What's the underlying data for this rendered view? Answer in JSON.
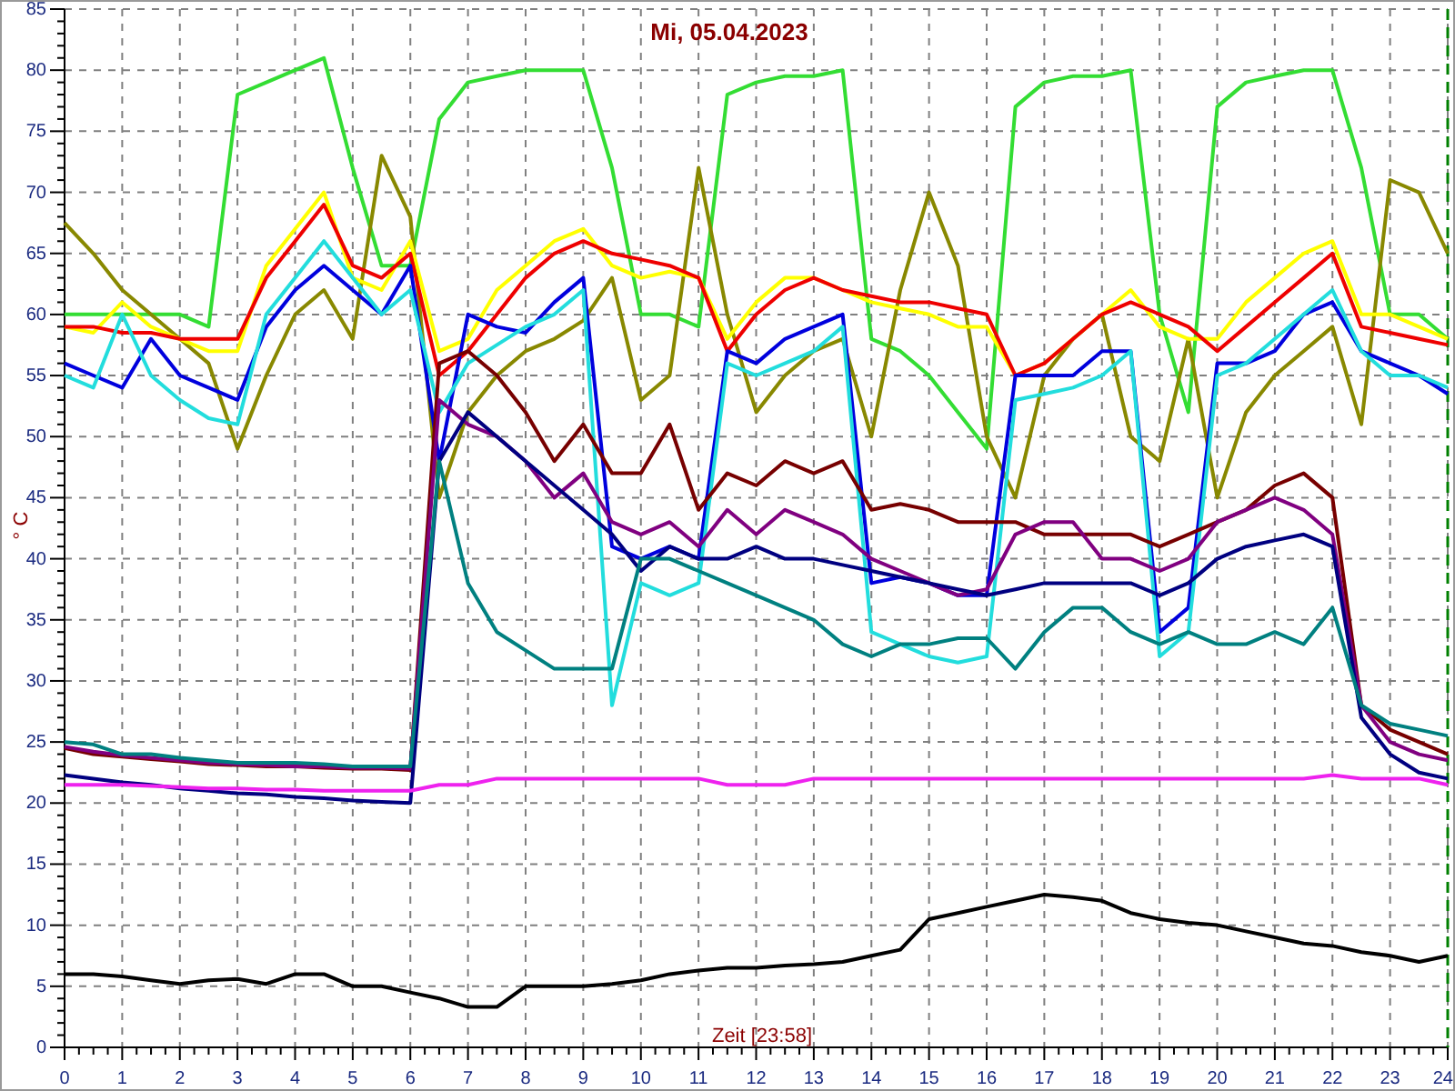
{
  "chart": {
    "chart_data": {
      "type": "line",
      "title": "Mi, 05.04.2023",
      "xlabel": "Zeit [23:58]",
      "ylabel": "° C",
      "grid": true,
      "xlim": [
        0,
        24
      ],
      "ylim": [
        0,
        85
      ],
      "xticks": [
        0,
        1,
        2,
        3,
        4,
        5,
        6,
        7,
        8,
        9,
        10,
        11,
        12,
        13,
        14,
        15,
        16,
        17,
        18,
        19,
        20,
        21,
        22,
        23,
        24
      ],
      "yticks": [
        0,
        5,
        10,
        15,
        20,
        25,
        30,
        35,
        40,
        45,
        50,
        55,
        60,
        65,
        70,
        75,
        80,
        85
      ],
      "x": [
        0,
        0.5,
        1,
        1.5,
        2,
        2.5,
        3,
        3.5,
        4,
        4.5,
        5,
        5.5,
        6,
        6.5,
        7,
        7.5,
        8,
        8.5,
        9,
        9.5,
        10,
        10.5,
        11,
        11.5,
        12,
        12.5,
        13,
        13.5,
        14,
        14.5,
        15,
        15.5,
        16,
        16.5,
        17,
        17.5,
        18,
        18.5,
        19,
        19.5,
        20,
        20.5,
        21,
        21.5,
        22,
        22.5,
        23,
        23.5,
        24
      ],
      "series": [
        {
          "color": "#33dd33",
          "values": [
            60,
            60,
            60,
            60,
            60,
            59,
            78,
            79,
            80,
            81,
            72,
            64,
            64,
            76,
            79,
            79.5,
            80,
            80,
            80,
            72,
            60,
            60,
            59,
            78,
            79,
            79.5,
            79.5,
            80,
            58,
            57,
            55,
            52,
            49,
            77,
            79,
            79.5,
            79.5,
            80,
            60,
            52,
            77,
            79,
            79.5,
            80,
            80,
            72,
            60,
            60,
            58
          ]
        },
        {
          "color": "#888800",
          "values": [
            67.5,
            65,
            62,
            60,
            58,
            56,
            49,
            55,
            60,
            62,
            58,
            73,
            68,
            45,
            52,
            55,
            57,
            58,
            59.5,
            63,
            53,
            55,
            72,
            60,
            52,
            55,
            57,
            58,
            50,
            62,
            70,
            64,
            50,
            45,
            55,
            58,
            60,
            50,
            48,
            58,
            45,
            52,
            55,
            57,
            59,
            51,
            71,
            70,
            65
          ]
        },
        {
          "color": "#ffff00",
          "values": [
            59,
            58.5,
            61,
            59,
            58,
            57,
            57,
            64,
            67,
            70,
            63,
            62,
            66,
            57,
            58,
            62,
            64,
            66,
            67,
            64,
            63,
            63.5,
            63,
            58,
            61,
            63,
            63,
            62,
            61,
            60.5,
            60,
            59,
            59,
            55,
            56,
            58,
            60,
            62,
            59,
            58,
            58,
            61,
            63,
            65,
            66,
            60,
            60,
            59,
            58
          ]
        },
        {
          "color": "#ee0000",
          "values": [
            59,
            59,
            58.5,
            58.5,
            58,
            58,
            58,
            63,
            66,
            69,
            64,
            63,
            65,
            55,
            57,
            60,
            63,
            65,
            66,
            65,
            64.5,
            64,
            63,
            57,
            60,
            62,
            63,
            62,
            61.5,
            61,
            61,
            60.5,
            60,
            55,
            56,
            58,
            60,
            61,
            60,
            59,
            57,
            59,
            61,
            63,
            65,
            59,
            58.5,
            58,
            57.5
          ]
        },
        {
          "color": "#0000dd",
          "values": [
            56,
            55,
            54,
            58,
            55,
            54,
            53,
            59,
            62,
            64,
            62,
            60,
            64,
            48,
            60,
            59,
            58.5,
            61,
            63,
            41,
            40,
            41,
            40,
            57,
            56,
            58,
            59,
            60,
            38,
            38.5,
            38,
            37,
            37,
            55,
            55,
            55,
            57,
            57,
            34,
            36,
            56,
            56,
            57,
            60,
            61,
            57,
            56,
            55,
            53.5
          ]
        },
        {
          "color": "#22dddd",
          "values": [
            55,
            54,
            60,
            55,
            53,
            51.5,
            51,
            60,
            63,
            66,
            63,
            60,
            62,
            52,
            56,
            57.5,
            59,
            60,
            62,
            28,
            38,
            37,
            38,
            56,
            55,
            56,
            57,
            59,
            34,
            33,
            32,
            31.5,
            32,
            53,
            53.5,
            54,
            55,
            57,
            32,
            34,
            55,
            56,
            58,
            60,
            62,
            57,
            55,
            55,
            54
          ]
        },
        {
          "color": "#770000",
          "values": [
            24.5,
            24,
            23.8,
            23.6,
            23.4,
            23.2,
            23.1,
            23,
            23,
            22.9,
            22.8,
            22.8,
            22.7,
            56,
            57,
            55,
            52,
            48,
            51,
            47,
            47,
            51,
            44,
            47,
            46,
            48,
            47,
            48,
            44,
            44.5,
            44,
            43,
            43,
            43,
            42,
            42,
            42,
            42,
            41,
            42,
            43,
            44,
            46,
            47,
            45,
            28,
            26,
            25,
            24
          ]
        },
        {
          "color": "#800080",
          "values": [
            24.6,
            24.2,
            23.9,
            23.7,
            23.5,
            23.3,
            23.2,
            23.1,
            23,
            23,
            22.9,
            22.9,
            22.8,
            53,
            51,
            50,
            48,
            45,
            47,
            43,
            42,
            43,
            41,
            44,
            42,
            44,
            43,
            42,
            40,
            39,
            38,
            37,
            37.5,
            42,
            43,
            43,
            40,
            40,
            39,
            40,
            43,
            44,
            45,
            44,
            42,
            28,
            25,
            24,
            23.5
          ]
        },
        {
          "color": "#000080",
          "values": [
            22.3,
            22,
            21.7,
            21.5,
            21.2,
            21,
            20.8,
            20.7,
            20.5,
            20.4,
            20.2,
            20.1,
            20,
            48,
            52,
            50,
            48,
            46,
            44,
            42,
            39,
            41,
            40,
            40,
            41,
            40,
            40,
            39.5,
            39,
            38.5,
            38,
            37.5,
            37,
            37.5,
            38,
            38,
            38,
            38,
            37,
            38,
            40,
            41,
            41.5,
            42,
            41,
            27,
            24,
            22.5,
            22
          ]
        },
        {
          "color": "#008080",
          "values": [
            25,
            24.8,
            24,
            24,
            23.7,
            23.5,
            23.3,
            23.3,
            23.3,
            23.2,
            23,
            23,
            23,
            48,
            38,
            34,
            32.5,
            31,
            31,
            31,
            40,
            40,
            39,
            38,
            37,
            36,
            35,
            33,
            32,
            33,
            33,
            33.5,
            33.5,
            31,
            34,
            36,
            36,
            34,
            33,
            34,
            33,
            33,
            34,
            33,
            36,
            28,
            26.5,
            26,
            25.5
          ]
        },
        {
          "color": "#ee22ee",
          "values": [
            21.5,
            21.5,
            21.5,
            21.4,
            21.3,
            21.2,
            21.2,
            21.1,
            21.1,
            21,
            21,
            21,
            21,
            21.5,
            21.5,
            22,
            22,
            22,
            22,
            22,
            22,
            22,
            22,
            21.5,
            21.5,
            21.5,
            22,
            22,
            22,
            22,
            22,
            22,
            22,
            22,
            22,
            22,
            22,
            22,
            22,
            22,
            22,
            22,
            22,
            22,
            22.3,
            22,
            22,
            22,
            21.5
          ]
        },
        {
          "color": "#000000",
          "values": [
            6,
            6,
            5.8,
            5.5,
            5.2,
            5.5,
            5.6,
            5.2,
            6,
            6,
            5,
            5,
            4.5,
            4,
            3.3,
            3.3,
            5,
            5,
            5,
            5.2,
            5.5,
            6,
            6.3,
            6.5,
            6.5,
            6.7,
            6.8,
            7,
            7.5,
            8,
            10.5,
            11,
            11.5,
            12,
            12.5,
            12.3,
            12,
            11,
            10.5,
            10.2,
            10,
            9.5,
            9,
            8.5,
            8.3,
            7.8,
            7.5,
            7,
            7.5
          ]
        }
      ]
    }
  }
}
